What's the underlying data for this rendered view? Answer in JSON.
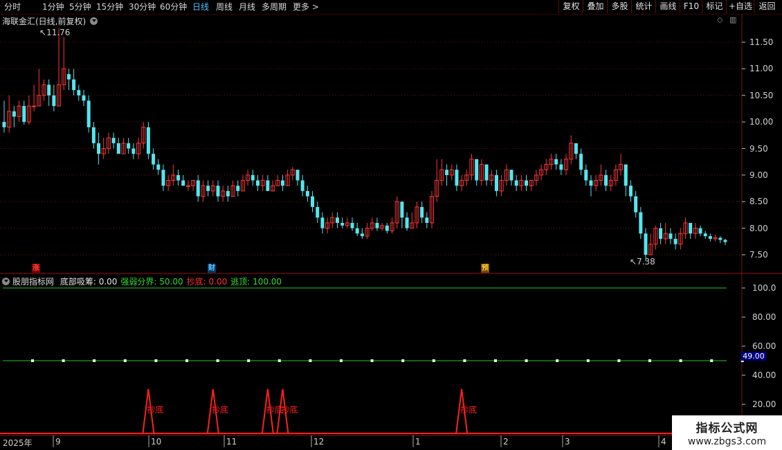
{
  "toolbar": {
    "periods": [
      "分时",
      "1分钟",
      "5分钟",
      "15分钟",
      "30分钟",
      "60分钟",
      "日线",
      "周线",
      "月线",
      "多周期",
      "更多 >"
    ],
    "active_period": "日线",
    "right_buttons": [
      "复权",
      "叠加",
      "多股",
      "统计",
      "画线",
      "F10",
      "标记",
      "+自选",
      "返回"
    ]
  },
  "stock": {
    "title": "海联金汇(日线,前复权)"
  },
  "price_axis": [
    "11.50",
    "11.00",
    "10.50",
    "10.00",
    "9.50",
    "9.00",
    "8.50",
    "8.00",
    "7.50"
  ],
  "annotations": {
    "high": "11.76",
    "low": "7.38"
  },
  "events": [
    {
      "label": "涨",
      "color": "#ff4040",
      "bg": "#7a0000"
    },
    {
      "label": "财",
      "color": "#60c0ff",
      "bg": "#003a6a"
    },
    {
      "label": "预",
      "color": "#ffcc33",
      "bg": "#7a4a00"
    }
  ],
  "indicator": {
    "name": "股朋指标网",
    "items": [
      {
        "label": "底部吸筹: 0.00",
        "color": "#e8e8e8"
      },
      {
        "label": "强弱分界: 50.00",
        "color": "#33dd33"
      },
      {
        "label": "抄底: 0.00",
        "color": "#ff3333"
      },
      {
        "label": "逃顶: 100.00",
        "color": "#33dd33"
      }
    ],
    "axis": [
      "100.0",
      "80.00",
      "60.00",
      "40.00",
      "20.00"
    ],
    "current_value": "49.00",
    "signal_label": "抄底"
  },
  "date_axis": [
    "2025年",
    "9",
    "10",
    "11",
    "12",
    "1",
    "2",
    "3",
    "4"
  ],
  "watermark": {
    "line1": "指标公式网",
    "line2": "www.zbgs3.com"
  },
  "colors": {
    "up": "#ff3838",
    "down": "#54e6ee",
    "grid": "#7a1010",
    "ma": "#22cc22",
    "signal": "#ff2020"
  },
  "chart_data": {
    "type": "candlestick",
    "title": "海联金汇(日线,前复权)",
    "ylim": [
      7.2,
      11.9
    ],
    "candles": [
      [
        10.0,
        9.9,
        10.4,
        9.8
      ],
      [
        9.9,
        10.2,
        10.5,
        9.8
      ],
      [
        10.2,
        10.1,
        10.3,
        9.9
      ],
      [
        10.1,
        10.3,
        10.4,
        10.0
      ],
      [
        10.3,
        10.0,
        10.4,
        9.95
      ],
      [
        10.0,
        10.3,
        10.5,
        9.95
      ],
      [
        10.3,
        10.3,
        10.7,
        10.2
      ],
      [
        10.3,
        10.5,
        11.0,
        10.3
      ],
      [
        10.5,
        10.7,
        10.8,
        10.4
      ],
      [
        10.7,
        10.5,
        10.8,
        10.3
      ],
      [
        10.5,
        10.3,
        10.7,
        10.2
      ],
      [
        10.3,
        10.7,
        11.76,
        10.3
      ],
      [
        10.7,
        11.0,
        11.6,
        10.6
      ],
      [
        10.9,
        10.8,
        11.0,
        10.6
      ],
      [
        10.8,
        10.6,
        11.0,
        10.5
      ],
      [
        10.6,
        10.5,
        10.7,
        10.4
      ],
      [
        10.5,
        10.4,
        10.6,
        10.3
      ],
      [
        10.4,
        9.9,
        10.5,
        9.8
      ],
      [
        9.9,
        9.6,
        10.0,
        9.5
      ],
      [
        9.6,
        9.4,
        9.8,
        9.2
      ],
      [
        9.4,
        9.5,
        9.7,
        9.3
      ],
      [
        9.5,
        9.7,
        9.8,
        9.4
      ],
      [
        9.7,
        9.6,
        9.8,
        9.5
      ],
      [
        9.6,
        9.4,
        9.7,
        9.4
      ],
      [
        9.4,
        9.6,
        9.7,
        9.4
      ],
      [
        9.6,
        9.5,
        9.7,
        9.4
      ],
      [
        9.5,
        9.4,
        9.6,
        9.3
      ],
      [
        9.4,
        9.6,
        9.7,
        9.3
      ],
      [
        9.6,
        9.9,
        10.0,
        9.5
      ],
      [
        9.9,
        9.4,
        10.0,
        9.3
      ],
      [
        9.4,
        9.2,
        9.5,
        9.1
      ],
      [
        9.2,
        9.1,
        9.3,
        9.0
      ],
      [
        9.1,
        8.8,
        9.2,
        8.7
      ],
      [
        8.8,
        8.9,
        9.0,
        8.7
      ],
      [
        8.9,
        9.0,
        9.2,
        8.8
      ],
      [
        9.0,
        8.9,
        9.1,
        8.8
      ],
      [
        8.9,
        8.8,
        9.0,
        8.8
      ],
      [
        8.8,
        8.8,
        8.9,
        8.7
      ],
      [
        8.8,
        8.9,
        8.9,
        8.7
      ],
      [
        8.9,
        8.6,
        9.0,
        8.5
      ],
      [
        8.6,
        8.8,
        8.9,
        8.5
      ],
      [
        8.8,
        8.7,
        8.9,
        8.6
      ],
      [
        8.7,
        8.8,
        8.9,
        8.6
      ],
      [
        8.8,
        8.6,
        8.9,
        8.5
      ],
      [
        8.6,
        8.7,
        8.8,
        8.5
      ],
      [
        8.7,
        8.6,
        8.8,
        8.5
      ],
      [
        8.6,
        8.8,
        8.9,
        8.6
      ],
      [
        8.8,
        8.7,
        8.9,
        8.6
      ],
      [
        8.7,
        8.9,
        9.0,
        8.7
      ],
      [
        8.9,
        9.0,
        9.1,
        8.8
      ],
      [
        9.0,
        8.9,
        9.1,
        8.8
      ],
      [
        8.9,
        8.8,
        9.0,
        8.7
      ],
      [
        8.8,
        8.9,
        9.0,
        8.7
      ],
      [
        8.9,
        8.7,
        9.0,
        8.7
      ],
      [
        8.7,
        8.8,
        8.9,
        8.7
      ],
      [
        8.8,
        8.9,
        9.0,
        8.8
      ],
      [
        8.9,
        8.8,
        9.0,
        8.7
      ],
      [
        8.8,
        9.0,
        9.1,
        8.8
      ],
      [
        9.0,
        9.1,
        9.15,
        8.9
      ],
      [
        9.1,
        8.9,
        9.1,
        8.8
      ],
      [
        8.9,
        8.7,
        9.0,
        8.6
      ],
      [
        8.7,
        8.6,
        8.8,
        8.5
      ],
      [
        8.6,
        8.4,
        8.7,
        8.3
      ],
      [
        8.4,
        8.2,
        8.5,
        8.1
      ],
      [
        8.2,
        8.0,
        8.3,
        7.9
      ],
      [
        8.0,
        8.1,
        8.2,
        7.9
      ],
      [
        8.1,
        8.2,
        8.3,
        8.0
      ],
      [
        8.2,
        8.1,
        8.3,
        8.0
      ],
      [
        8.1,
        8.05,
        8.2,
        8.0
      ],
      [
        8.05,
        8.1,
        8.2,
        8.0
      ],
      [
        8.1,
        8.0,
        8.2,
        7.95
      ],
      [
        8.0,
        7.9,
        8.1,
        7.85
      ],
      [
        7.9,
        7.85,
        8.0,
        7.8
      ],
      [
        7.85,
        8.0,
        8.1,
        7.8
      ],
      [
        8.0,
        8.1,
        8.2,
        7.95
      ],
      [
        8.1,
        8.0,
        8.2,
        7.95
      ],
      [
        8.0,
        8.05,
        8.1,
        7.95
      ],
      [
        8.05,
        7.95,
        8.1,
        7.9
      ],
      [
        7.95,
        8.1,
        8.2,
        7.9
      ],
      [
        8.1,
        8.5,
        8.6,
        8.0
      ],
      [
        8.5,
        8.2,
        8.5,
        8.0
      ],
      [
        8.2,
        8.0,
        8.3,
        7.95
      ],
      [
        8.0,
        8.1,
        8.3,
        8.0
      ],
      [
        8.1,
        8.4,
        8.5,
        8.0
      ],
      [
        8.4,
        8.2,
        8.5,
        8.1
      ],
      [
        8.2,
        8.1,
        8.3,
        8.0
      ],
      [
        8.1,
        8.6,
        8.7,
        8.0
      ],
      [
        8.6,
        8.9,
        9.3,
        8.5
      ],
      [
        8.9,
        9.1,
        9.3,
        8.8
      ],
      [
        9.1,
        9.0,
        9.2,
        8.8
      ],
      [
        9.0,
        9.1,
        9.2,
        8.9
      ],
      [
        9.1,
        8.8,
        9.2,
        8.7
      ],
      [
        8.8,
        8.9,
        9.0,
        8.7
      ],
      [
        8.9,
        9.0,
        9.1,
        8.8
      ],
      [
        9.0,
        9.3,
        9.4,
        8.9
      ],
      [
        9.3,
        8.9,
        9.3,
        8.8
      ],
      [
        8.9,
        9.2,
        9.3,
        8.8
      ],
      [
        9.2,
        8.9,
        9.2,
        8.8
      ],
      [
        8.9,
        9.0,
        9.1,
        8.8
      ],
      [
        9.0,
        8.7,
        9.1,
        8.6
      ],
      [
        8.7,
        8.9,
        9.0,
        8.6
      ],
      [
        8.9,
        9.1,
        9.2,
        8.8
      ],
      [
        9.1,
        8.9,
        9.1,
        8.8
      ],
      [
        8.9,
        8.8,
        9.0,
        8.7
      ],
      [
        8.8,
        8.9,
        9.0,
        8.7
      ],
      [
        8.9,
        8.8,
        9.0,
        8.7
      ],
      [
        8.8,
        8.9,
        8.9,
        8.7
      ],
      [
        8.9,
        9.0,
        9.1,
        8.8
      ],
      [
        9.0,
        9.1,
        9.2,
        8.9
      ],
      [
        9.1,
        9.2,
        9.3,
        9.0
      ],
      [
        9.2,
        9.3,
        9.4,
        9.1
      ],
      [
        9.3,
        9.2,
        9.4,
        9.1
      ],
      [
        9.2,
        9.1,
        9.3,
        9.0
      ],
      [
        9.1,
        9.3,
        9.4,
        9.0
      ],
      [
        9.3,
        9.6,
        9.75,
        9.2
      ],
      [
        9.6,
        9.4,
        9.6,
        9.3
      ],
      [
        9.4,
        9.1,
        9.5,
        9.0
      ],
      [
        9.1,
        8.9,
        9.2,
        8.8
      ],
      [
        8.9,
        8.8,
        9.0,
        8.6
      ],
      [
        8.8,
        8.9,
        9.0,
        8.7
      ],
      [
        8.9,
        9.0,
        9.2,
        8.8
      ],
      [
        9.0,
        8.8,
        9.1,
        8.7
      ],
      [
        8.8,
        8.9,
        9.0,
        8.7
      ],
      [
        8.9,
        9.1,
        9.2,
        8.8
      ],
      [
        9.1,
        9.2,
        9.4,
        9.0
      ],
      [
        9.2,
        8.8,
        9.2,
        8.6
      ],
      [
        8.8,
        8.6,
        8.9,
        8.5
      ],
      [
        8.6,
        8.3,
        8.7,
        8.2
      ],
      [
        8.3,
        7.9,
        8.4,
        7.8
      ],
      [
        7.9,
        7.5,
        8.0,
        7.38
      ],
      [
        7.5,
        7.7,
        7.9,
        7.5
      ],
      [
        7.7,
        8.0,
        8.05,
        7.6
      ],
      [
        8.0,
        7.8,
        8.1,
        7.7
      ],
      [
        7.8,
        7.9,
        8.1,
        7.7
      ],
      [
        7.9,
        7.8,
        8.0,
        7.7
      ],
      [
        7.8,
        7.7,
        7.9,
        7.6
      ],
      [
        7.7,
        7.9,
        8.0,
        7.6
      ],
      [
        7.9,
        8.1,
        8.2,
        7.8
      ],
      [
        8.1,
        7.9,
        8.1,
        7.8
      ],
      [
        7.9,
        8.0,
        8.1,
        7.8
      ],
      [
        8.0,
        7.9,
        8.05,
        7.85
      ],
      [
        7.9,
        7.85,
        7.95,
        7.8
      ],
      [
        7.85,
        7.8,
        7.9,
        7.75
      ],
      [
        7.8,
        7.82,
        7.88,
        7.75
      ],
      [
        7.82,
        7.78,
        7.85,
        7.72
      ],
      [
        7.78,
        7.74,
        7.8,
        7.68
      ]
    ],
    "candle_fields": [
      "open",
      "close",
      "high",
      "low"
    ],
    "indicator_series": {
      "强弱分界": 50,
      "逃顶": 100,
      "抄底_signal_indices": [
        29,
        42,
        53,
        56,
        92
      ]
    }
  }
}
